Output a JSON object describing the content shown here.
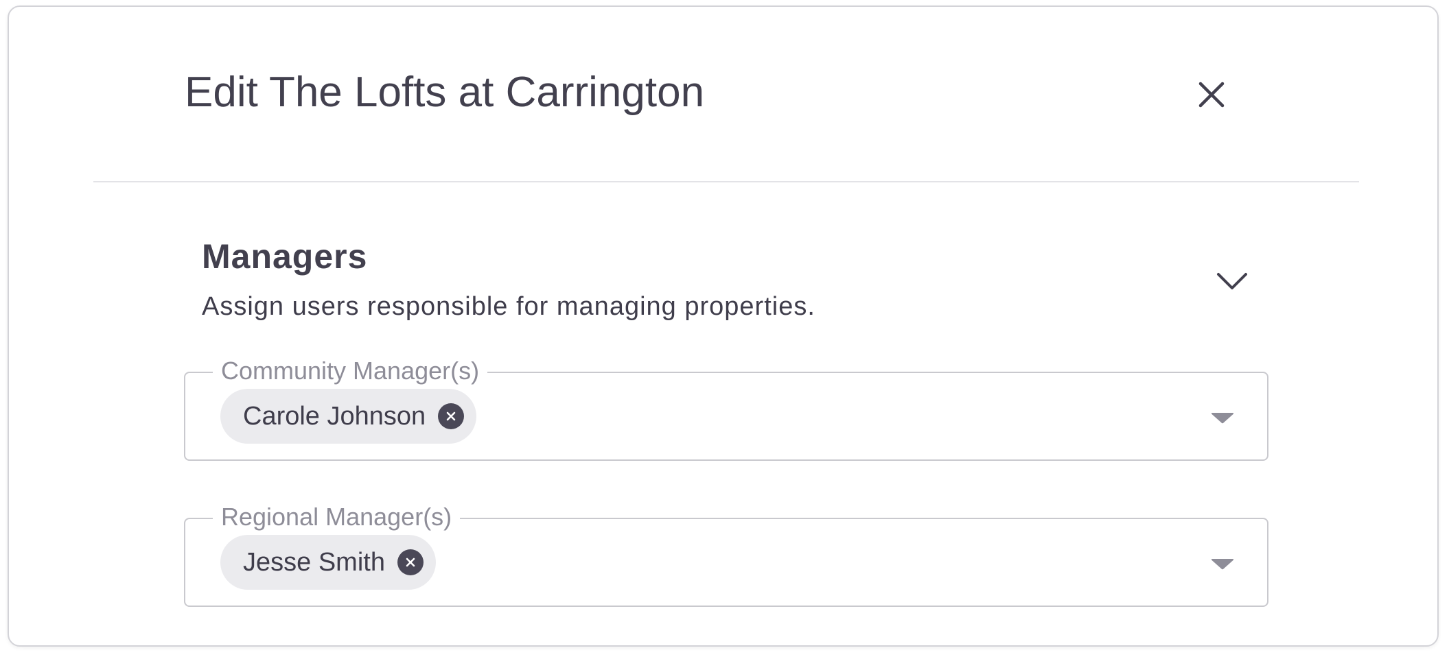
{
  "dialog": {
    "title": "Edit The Lofts at Carrington",
    "close_icon": "close-icon"
  },
  "section": {
    "title": "Managers",
    "description": "Assign users responsible for managing properties.",
    "toggle_icon": "chevron-down-icon"
  },
  "fields": [
    {
      "label": "Community Manager(s)",
      "chips": [
        {
          "label": "Carole Johnson",
          "remove_icon": "remove-chip-icon"
        }
      ],
      "dropdown_icon": "caret-down-icon"
    },
    {
      "label": "Regional Manager(s)",
      "chips": [
        {
          "label": "Jesse Smith",
          "remove_icon": "remove-chip-icon"
        }
      ],
      "dropdown_icon": "caret-down-icon"
    }
  ],
  "colors": {
    "text": "#42404e",
    "muted_label": "#8e8d98",
    "chip_bg": "#ebebee",
    "chip_remove_bg": "#4a4857",
    "border": "#c9c9ce"
  }
}
